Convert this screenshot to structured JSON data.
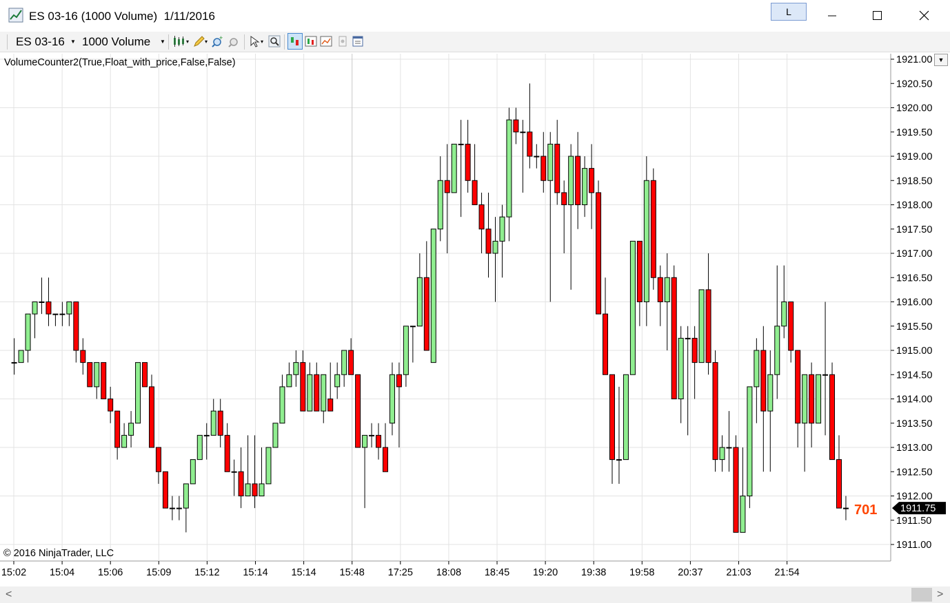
{
  "window": {
    "title": "ES 03-16 (1000 Volume)  1/11/2016",
    "layout_button_label": "L",
    "controls": [
      "minimize-icon",
      "maximize-icon",
      "close-icon"
    ]
  },
  "toolbar": {
    "instrument": "ES 03-16",
    "period": "1000 Volume",
    "icons": [
      "bar-style-icon",
      "drawing-tool-icon",
      "zoom-in-icon",
      "zoom-out-icon",
      "cursor-icon",
      "magnifier-icon",
      "chart-trader-icon",
      "strategies-icon",
      "indicators-icon",
      "data-box-icon",
      "properties-icon"
    ]
  },
  "chart": {
    "indicator_label": "VolumeCounter2(True,Float_with_price,False,False)",
    "copyright": "© 2016 NinjaTrader, LLC",
    "volume_counter": "701",
    "last_price_label": "1911.75",
    "colors": {
      "up": "#90ee90",
      "down": "#ff0000",
      "grid": "#e3e3e3",
      "counter": "#ff4500",
      "price_marker": "#000000"
    }
  },
  "chart_data": {
    "type": "candlestick",
    "y_tick_labels": [
      "1921.00",
      "1920.50",
      "1920.00",
      "1919.50",
      "1919.00",
      "1918.50",
      "1918.00",
      "1917.50",
      "1917.00",
      "1916.50",
      "1916.00",
      "1915.50",
      "1915.00",
      "1914.50",
      "1914.00",
      "1913.50",
      "1913.00",
      "1912.50",
      "1912.00",
      "1911.50",
      "1911.00"
    ],
    "x_tick_labels": [
      "15:02",
      "15:04",
      "15:06",
      "15:09",
      "15:12",
      "15:14",
      "15:14",
      "15:48",
      "17:25",
      "18:08",
      "18:45",
      "19:20",
      "19:38",
      "19:58",
      "20:37",
      "21:03",
      "21:54"
    ],
    "ylim": [
      1910.75,
      1921.25
    ],
    "candles": [
      {
        "o": 1914.75,
        "h": 1915.25,
        "l": 1914.5,
        "c": 1914.75
      },
      {
        "o": 1914.75,
        "h": 1915.0,
        "l": 1914.75,
        "c": 1915.0
      },
      {
        "o": 1915.0,
        "h": 1915.75,
        "l": 1914.75,
        "c": 1915.75
      },
      {
        "o": 1915.75,
        "h": 1916.0,
        "l": 1915.25,
        "c": 1916.0
      },
      {
        "o": 1916.0,
        "h": 1916.5,
        "l": 1915.75,
        "c": 1916.0
      },
      {
        "o": 1916.0,
        "h": 1916.5,
        "l": 1915.5,
        "c": 1915.75
      },
      {
        "o": 1915.75,
        "h": 1915.75,
        "l": 1915.5,
        "c": 1915.75
      },
      {
        "o": 1915.75,
        "h": 1916.0,
        "l": 1915.5,
        "c": 1915.75
      },
      {
        "o": 1915.75,
        "h": 1916.0,
        "l": 1915.5,
        "c": 1916.0
      },
      {
        "o": 1916.0,
        "h": 1916.0,
        "l": 1914.75,
        "c": 1915.0
      },
      {
        "o": 1915.0,
        "h": 1915.25,
        "l": 1914.5,
        "c": 1914.75
      },
      {
        "o": 1914.75,
        "h": 1914.75,
        "l": 1914.25,
        "c": 1914.25
      },
      {
        "o": 1914.25,
        "h": 1914.75,
        "l": 1914.0,
        "c": 1914.75
      },
      {
        "o": 1914.75,
        "h": 1914.75,
        "l": 1914.0,
        "c": 1914.0
      },
      {
        "o": 1914.0,
        "h": 1914.25,
        "l": 1913.5,
        "c": 1913.75
      },
      {
        "o": 1913.75,
        "h": 1913.75,
        "l": 1912.75,
        "c": 1913.0
      },
      {
        "o": 1913.0,
        "h": 1913.5,
        "l": 1913.0,
        "c": 1913.25
      },
      {
        "o": 1913.25,
        "h": 1913.75,
        "l": 1913.0,
        "c": 1913.5
      },
      {
        "o": 1913.5,
        "h": 1914.75,
        "l": 1913.5,
        "c": 1914.75
      },
      {
        "o": 1914.75,
        "h": 1914.75,
        "l": 1914.25,
        "c": 1914.25
      },
      {
        "o": 1914.25,
        "h": 1914.5,
        "l": 1913.0,
        "c": 1913.0
      },
      {
        "o": 1913.0,
        "h": 1913.0,
        "l": 1912.25,
        "c": 1912.5
      },
      {
        "o": 1912.5,
        "h": 1912.5,
        "l": 1911.75,
        "c": 1911.75
      },
      {
        "o": 1911.75,
        "h": 1912.0,
        "l": 1911.5,
        "c": 1911.75
      },
      {
        "o": 1911.75,
        "h": 1912.0,
        "l": 1911.5,
        "c": 1911.75
      },
      {
        "o": 1911.75,
        "h": 1912.25,
        "l": 1911.25,
        "c": 1912.25
      },
      {
        "o": 1912.25,
        "h": 1912.75,
        "l": 1912.25,
        "c": 1912.75
      },
      {
        "o": 1912.75,
        "h": 1913.25,
        "l": 1912.75,
        "c": 1913.25
      },
      {
        "o": 1913.25,
        "h": 1913.5,
        "l": 1912.75,
        "c": 1913.25
      },
      {
        "o": 1913.25,
        "h": 1914.0,
        "l": 1913.25,
        "c": 1913.75
      },
      {
        "o": 1913.75,
        "h": 1914.0,
        "l": 1913.0,
        "c": 1913.25
      },
      {
        "o": 1913.25,
        "h": 1913.5,
        "l": 1912.5,
        "c": 1912.5
      },
      {
        "o": 1912.5,
        "h": 1912.75,
        "l": 1912.0,
        "c": 1912.5
      },
      {
        "o": 1912.5,
        "h": 1913.0,
        "l": 1911.75,
        "c": 1912.0
      },
      {
        "o": 1912.0,
        "h": 1913.25,
        "l": 1912.0,
        "c": 1912.25
      },
      {
        "o": 1912.25,
        "h": 1913.25,
        "l": 1911.75,
        "c": 1912.0
      },
      {
        "o": 1912.0,
        "h": 1913.0,
        "l": 1912.0,
        "c": 1912.25
      },
      {
        "o": 1912.25,
        "h": 1913.0,
        "l": 1912.25,
        "c": 1913.0
      },
      {
        "o": 1913.0,
        "h": 1913.5,
        "l": 1913.0,
        "c": 1913.5
      },
      {
        "o": 1913.5,
        "h": 1914.5,
        "l": 1913.5,
        "c": 1914.25
      },
      {
        "o": 1914.25,
        "h": 1914.75,
        "l": 1914.25,
        "c": 1914.5
      },
      {
        "o": 1914.5,
        "h": 1915.0,
        "l": 1914.25,
        "c": 1914.75
      },
      {
        "o": 1914.75,
        "h": 1915.0,
        "l": 1913.75,
        "c": 1913.75
      },
      {
        "o": 1913.75,
        "h": 1914.75,
        "l": 1913.75,
        "c": 1914.5
      },
      {
        "o": 1914.5,
        "h": 1914.75,
        "l": 1913.75,
        "c": 1913.75
      },
      {
        "o": 1913.75,
        "h": 1914.5,
        "l": 1913.5,
        "c": 1914.5
      },
      {
        "o": 1914.0,
        "h": 1914.75,
        "l": 1913.75,
        "c": 1913.75
      },
      {
        "o": 1914.25,
        "h": 1914.75,
        "l": 1914.0,
        "c": 1914.5
      },
      {
        "o": 1914.5,
        "h": 1915.0,
        "l": 1914.25,
        "c": 1915.0
      },
      {
        "o": 1915.0,
        "h": 1915.25,
        "l": 1914.5,
        "c": 1914.5
      },
      {
        "o": 1914.5,
        "h": 1914.5,
        "l": 1913.0,
        "c": 1913.0
      },
      {
        "o": 1913.0,
        "h": 1913.25,
        "l": 1911.75,
        "c": 1913.25
      },
      {
        "o": 1913.25,
        "h": 1913.5,
        "l": 1913.0,
        "c": 1913.25
      },
      {
        "o": 1913.25,
        "h": 1913.5,
        "l": 1912.75,
        "c": 1913.0
      },
      {
        "o": 1913.0,
        "h": 1913.5,
        "l": 1912.5,
        "c": 1912.5
      },
      {
        "o": 1913.5,
        "h": 1914.75,
        "l": 1913.25,
        "c": 1914.5
      },
      {
        "o": 1914.5,
        "h": 1914.75,
        "l": 1913.0,
        "c": 1914.25
      },
      {
        "o": 1914.5,
        "h": 1915.5,
        "l": 1914.25,
        "c": 1915.5
      },
      {
        "o": 1915.5,
        "h": 1915.5,
        "l": 1914.75,
        "c": 1915.5
      },
      {
        "o": 1915.5,
        "h": 1917.0,
        "l": 1915.5,
        "c": 1916.5
      },
      {
        "o": 1916.5,
        "h": 1917.25,
        "l": 1915.25,
        "c": 1915.0
      },
      {
        "o": 1914.75,
        "h": 1917.5,
        "l": 1914.75,
        "c": 1917.5
      },
      {
        "o": 1917.5,
        "h": 1919.0,
        "l": 1917.25,
        "c": 1918.5
      },
      {
        "o": 1918.5,
        "h": 1919.25,
        "l": 1917.0,
        "c": 1918.25
      },
      {
        "o": 1918.25,
        "h": 1918.75,
        "l": 1918.25,
        "c": 1919.25
      },
      {
        "o": 1919.25,
        "h": 1919.75,
        "l": 1917.75,
        "c": 1919.25
      },
      {
        "o": 1919.25,
        "h": 1919.75,
        "l": 1918.25,
        "c": 1918.5
      },
      {
        "o": 1918.5,
        "h": 1919.25,
        "l": 1918.0,
        "c": 1918.0
      },
      {
        "o": 1918.0,
        "h": 1918.25,
        "l": 1917.0,
        "c": 1917.5
      },
      {
        "o": 1917.5,
        "h": 1918.25,
        "l": 1916.5,
        "c": 1917.0
      },
      {
        "o": 1917.0,
        "h": 1917.75,
        "l": 1916.0,
        "c": 1917.25
      },
      {
        "o": 1917.25,
        "h": 1918.0,
        "l": 1916.5,
        "c": 1917.75
      },
      {
        "o": 1917.75,
        "h": 1920.0,
        "l": 1917.25,
        "c": 1919.75
      },
      {
        "o": 1919.75,
        "h": 1920.0,
        "l": 1919.25,
        "c": 1919.5
      },
      {
        "o": 1919.5,
        "h": 1919.75,
        "l": 1918.25,
        "c": 1919.5
      },
      {
        "o": 1919.5,
        "h": 1920.5,
        "l": 1918.75,
        "c": 1919.0
      },
      {
        "o": 1919.0,
        "h": 1919.25,
        "l": 1918.75,
        "c": 1919.0
      },
      {
        "o": 1919.0,
        "h": 1919.5,
        "l": 1918.25,
        "c": 1918.5
      },
      {
        "o": 1918.5,
        "h": 1919.5,
        "l": 1916.0,
        "c": 1919.25
      },
      {
        "o": 1919.25,
        "h": 1919.75,
        "l": 1918.0,
        "c": 1918.25
      },
      {
        "o": 1918.25,
        "h": 1918.5,
        "l": 1917.0,
        "c": 1918.0
      },
      {
        "o": 1918.0,
        "h": 1919.25,
        "l": 1916.25,
        "c": 1919.0
      },
      {
        "o": 1919.0,
        "h": 1919.5,
        "l": 1917.5,
        "c": 1918.0
      },
      {
        "o": 1918.0,
        "h": 1919.0,
        "l": 1917.75,
        "c": 1918.75
      },
      {
        "o": 1918.75,
        "h": 1919.25,
        "l": 1917.5,
        "c": 1918.25
      },
      {
        "o": 1918.25,
        "h": 1918.5,
        "l": 1915.75,
        "c": 1915.75
      },
      {
        "o": 1915.75,
        "h": 1916.5,
        "l": 1914.5,
        "c": 1914.5
      },
      {
        "o": 1914.5,
        "h": 1914.5,
        "l": 1912.25,
        "c": 1912.75
      },
      {
        "o": 1912.75,
        "h": 1914.25,
        "l": 1912.25,
        "c": 1912.75
      },
      {
        "o": 1912.75,
        "h": 1914.5,
        "l": 1912.75,
        "c": 1914.5
      },
      {
        "o": 1914.5,
        "h": 1917.25,
        "l": 1914.5,
        "c": 1917.25
      },
      {
        "o": 1917.25,
        "h": 1917.25,
        "l": 1915.5,
        "c": 1916.0
      },
      {
        "o": 1916.0,
        "h": 1919.0,
        "l": 1915.5,
        "c": 1918.5
      },
      {
        "o": 1918.5,
        "h": 1918.75,
        "l": 1916.25,
        "c": 1916.5
      },
      {
        "o": 1916.5,
        "h": 1916.75,
        "l": 1915.5,
        "c": 1916.0
      },
      {
        "o": 1916.0,
        "h": 1917.0,
        "l": 1915.0,
        "c": 1916.5
      },
      {
        "o": 1916.5,
        "h": 1916.75,
        "l": 1914.0,
        "c": 1914.0
      },
      {
        "o": 1914.0,
        "h": 1915.5,
        "l": 1913.5,
        "c": 1915.25
      },
      {
        "o": 1915.25,
        "h": 1915.5,
        "l": 1913.25,
        "c": 1915.25
      },
      {
        "o": 1915.25,
        "h": 1915.5,
        "l": 1914.0,
        "c": 1914.75
      },
      {
        "o": 1914.75,
        "h": 1916.25,
        "l": 1914.75,
        "c": 1916.25
      },
      {
        "o": 1916.25,
        "h": 1917.0,
        "l": 1914.5,
        "c": 1914.75
      },
      {
        "o": 1914.75,
        "h": 1915.0,
        "l": 1912.5,
        "c": 1912.75
      },
      {
        "o": 1912.75,
        "h": 1913.25,
        "l": 1912.5,
        "c": 1913.0
      },
      {
        "o": 1913.0,
        "h": 1913.75,
        "l": 1912.5,
        "c": 1913.0
      },
      {
        "o": 1913.0,
        "h": 1913.25,
        "l": 1911.25,
        "c": 1911.25
      },
      {
        "o": 1911.25,
        "h": 1913.0,
        "l": 1911.25,
        "c": 1912.0
      },
      {
        "o": 1912.0,
        "h": 1914.25,
        "l": 1911.75,
        "c": 1914.25
      },
      {
        "o": 1914.25,
        "h": 1915.25,
        "l": 1913.5,
        "c": 1915.0
      },
      {
        "o": 1915.0,
        "h": 1915.5,
        "l": 1912.5,
        "c": 1913.75
      },
      {
        "o": 1913.75,
        "h": 1915.0,
        "l": 1912.5,
        "c": 1914.5
      },
      {
        "o": 1914.5,
        "h": 1916.75,
        "l": 1914.0,
        "c": 1915.5
      },
      {
        "o": 1915.5,
        "h": 1916.75,
        "l": 1915.25,
        "c": 1916.0
      },
      {
        "o": 1916.0,
        "h": 1916.0,
        "l": 1914.75,
        "c": 1915.0
      },
      {
        "o": 1915.0,
        "h": 1915.0,
        "l": 1913.0,
        "c": 1913.5
      },
      {
        "o": 1913.5,
        "h": 1914.5,
        "l": 1912.5,
        "c": 1914.5
      },
      {
        "o": 1914.5,
        "h": 1914.75,
        "l": 1913.0,
        "c": 1913.5
      },
      {
        "o": 1913.5,
        "h": 1914.5,
        "l": 1913.5,
        "c": 1914.5
      },
      {
        "o": 1914.5,
        "h": 1916.0,
        "l": 1913.25,
        "c": 1914.5
      },
      {
        "o": 1914.5,
        "h": 1914.75,
        "l": 1912.75,
        "c": 1912.75
      },
      {
        "o": 1912.75,
        "h": 1913.25,
        "l": 1912.0,
        "c": 1911.75
      },
      {
        "o": 1911.75,
        "h": 1912.0,
        "l": 1911.5,
        "c": 1911.75
      }
    ]
  }
}
